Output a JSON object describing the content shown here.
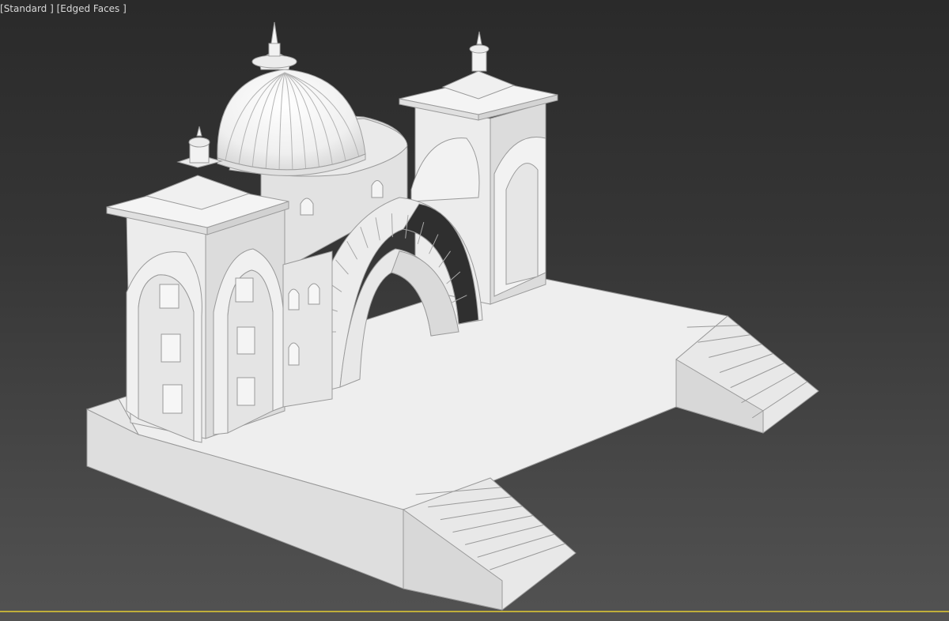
{
  "viewport": {
    "label_prefix": "[",
    "shading_mode": "Standard",
    "label_mid": " ] [",
    "display_mode": "Edged Faces",
    "label_suffix": " ]",
    "background_top": "#2a2a2a",
    "background_bottom": "#525252",
    "active_frame_color": "#bfae3a"
  },
  "model": {
    "fill_light": "#f2f2f2",
    "fill_mid": "#e4e4e4",
    "fill_shadow": "#d2d2d2",
    "edge_color": "#9a9a9a"
  }
}
